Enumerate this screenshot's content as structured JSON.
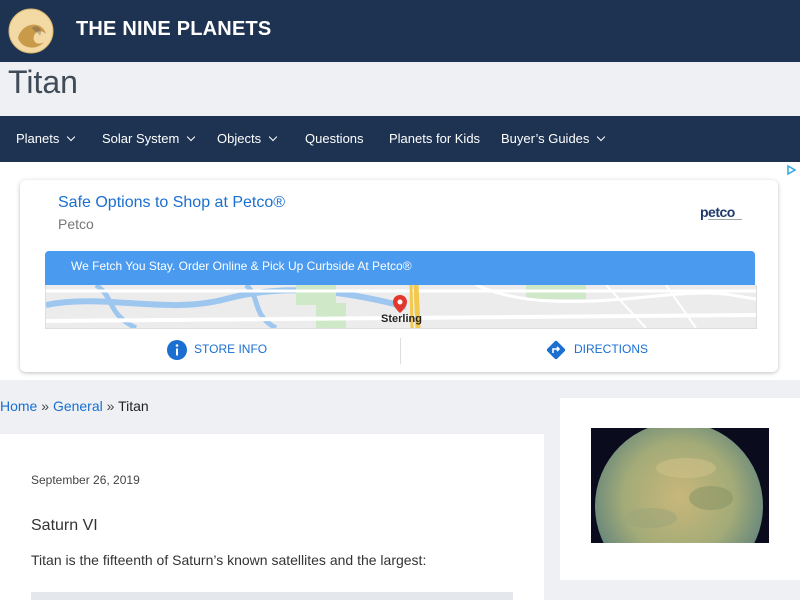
{
  "header": {
    "site_title": "THE NINE PLANETS"
  },
  "page": {
    "title": "Titan"
  },
  "nav": {
    "items": [
      {
        "label": "Planets"
      },
      {
        "label": "Solar System"
      },
      {
        "label": "Objects"
      },
      {
        "label": "Questions"
      },
      {
        "label": "Planets for Kids"
      },
      {
        "label": "Buyer’s Guides"
      }
    ]
  },
  "ad": {
    "headline": "Safe Options to Shop at Petco®",
    "advertiser": "Petco",
    "brand_logo": "petco",
    "banner_text": "We Fetch You Stay. Order Online & Pick Up Curbside At Petco®",
    "map_label": "Sterling",
    "store_info_label": "STORE INFO",
    "directions_label": "DIRECTIONS",
    "accent_color": "#1a6fd1",
    "banner_color": "#4a9af0"
  },
  "breadcrumb": {
    "home": "Home",
    "sep1": "»",
    "general": "General",
    "sep2": "»",
    "current": "Titan"
  },
  "article": {
    "date": "September 26, 2019",
    "subtitle": "Saturn VI",
    "intro": "Titan is the fifteenth of Saturn’s known satellites and the largest:"
  },
  "colors": {
    "header_bg": "#1e3352",
    "page_bg": "#eef0f4"
  }
}
